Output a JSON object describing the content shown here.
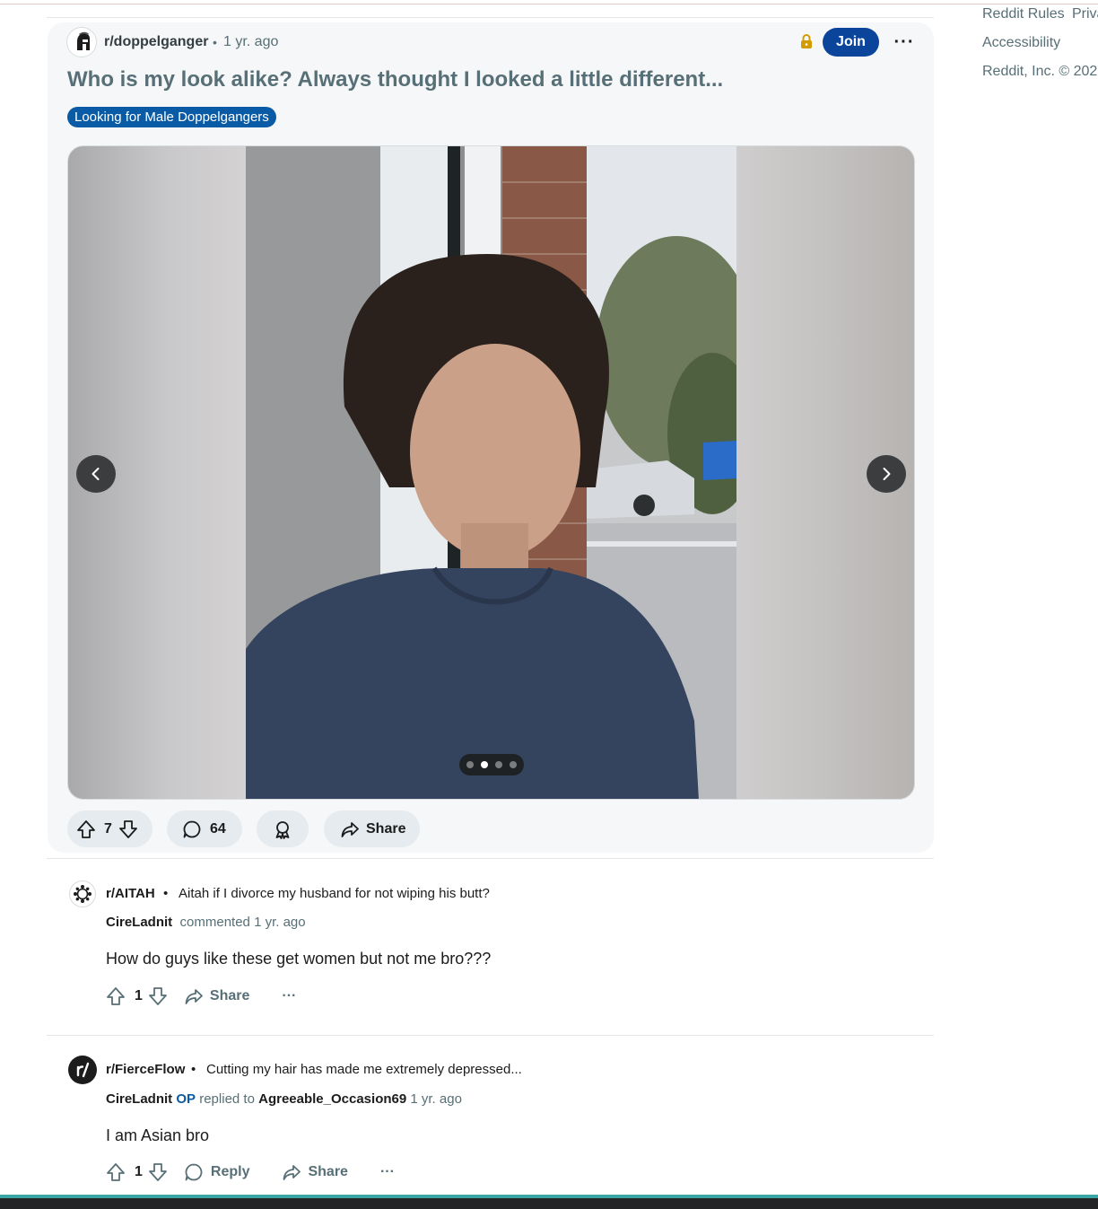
{
  "sidebar_links": {
    "reddit_rules": "Reddit Rules",
    "privacy": "Priva",
    "accessibility": "Accessibility",
    "copyright": "Reddit, Inc. © 202"
  },
  "post": {
    "subreddit": "r/doppelganger",
    "separator": "•",
    "time": "1 yr. ago",
    "join_label": "Join",
    "more_label": "···",
    "title": "Who is my look alike? Always thought I looked a little different...",
    "flair": "Looking for Male Doppelgangers",
    "gallery": {
      "total_images": 4,
      "current_index": 2
    },
    "votes": "7",
    "comments": "64",
    "share_label": "Share"
  },
  "comments": [
    {
      "subreddit": "r/AITAH",
      "separator": "•",
      "post_title": "Aitah if I divorce my husband for not wiping his butt?",
      "author": "CireLadnit",
      "action": "commented",
      "time": "1 yr. ago",
      "body": "How do guys like these get women but not me bro???",
      "votes": "1",
      "share_label": "Share",
      "more_label": "···"
    },
    {
      "subreddit": "r/FierceFlow",
      "separator": "•",
      "post_title": "Cutting my hair has made me extremely depressed...",
      "author": "CireLadnit",
      "op_badge": "OP",
      "action": "replied to",
      "reply_to": "Agreeable_Occasion69",
      "time": "1 yr. ago",
      "body": "I am Asian bro",
      "votes": "1",
      "reply_label": "Reply",
      "share_label": "Share",
      "more_label": "···"
    }
  ],
  "colors": {
    "join_button": "#0a449b",
    "flair": "#0a5ba6",
    "muted_text": "#576f76",
    "card_bg": "#f6f7f8",
    "pill_bg": "#e5ebee"
  }
}
